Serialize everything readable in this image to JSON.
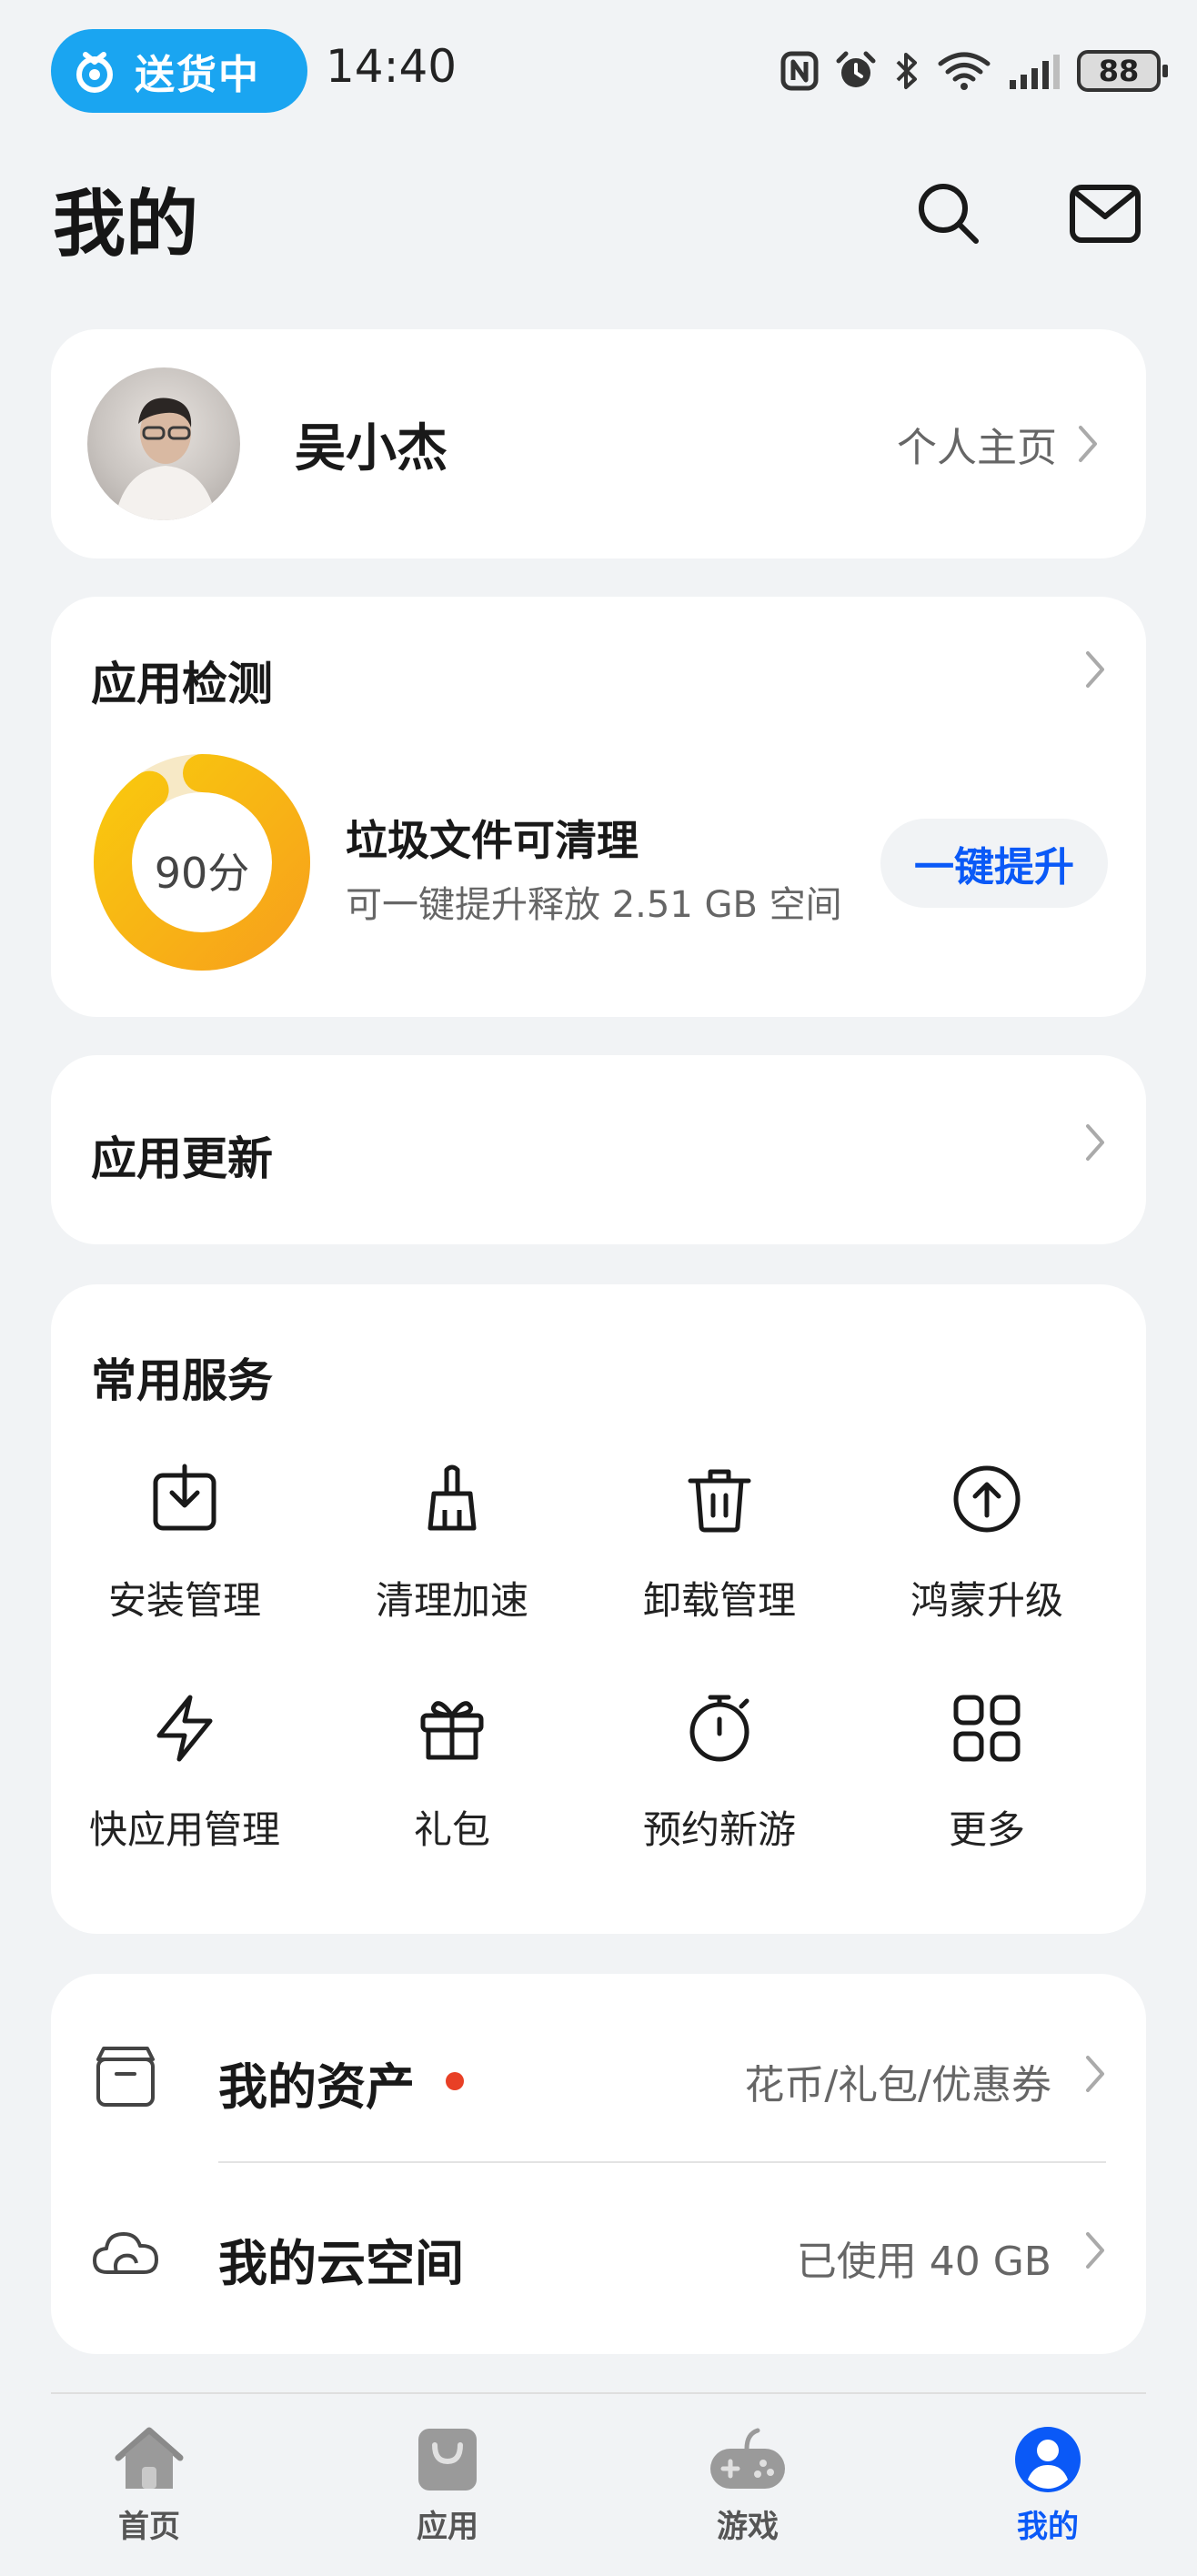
{
  "status_bar": {
    "delivery_label": "送货中",
    "time": "14:40",
    "battery": "88"
  },
  "header": {
    "title": "我的",
    "icons": [
      "search-icon",
      "mail-icon"
    ]
  },
  "profile": {
    "name": "吴小杰",
    "link_label": "个人主页"
  },
  "app_check": {
    "title": "应用检测",
    "score_label": "90分",
    "score": 90,
    "junk_title": "垃圾文件可清理",
    "junk_subtitle": "可一键提升释放 2.51 GB 空间",
    "button_label": "一键提升",
    "ring_colors": [
      "#f7a21b",
      "#f9c80e"
    ]
  },
  "app_update": {
    "title": "应用更新"
  },
  "services": {
    "title": "常用服务",
    "items": [
      {
        "label": "安装管理",
        "icon": "install-icon"
      },
      {
        "label": "清理加速",
        "icon": "broom-icon"
      },
      {
        "label": "卸载管理",
        "icon": "trash-icon"
      },
      {
        "label": "鸿蒙升级",
        "icon": "upgrade-icon"
      },
      {
        "label": "快应用管理",
        "icon": "lightning-icon"
      },
      {
        "label": "礼包",
        "icon": "gift-icon"
      },
      {
        "label": "预约新游",
        "icon": "stopwatch-icon"
      },
      {
        "label": "更多",
        "icon": "grid-icon"
      }
    ]
  },
  "assets": {
    "rows": [
      {
        "title": "我的资产",
        "value": "花币/礼包/优惠券",
        "icon": "box-icon",
        "has_dot": true
      },
      {
        "title": "我的云空间",
        "value": "已使用 40 GB",
        "icon": "cloud-icon",
        "has_dot": false
      }
    ]
  },
  "tabs": [
    {
      "label": "首页",
      "icon": "home-icon",
      "active": false
    },
    {
      "label": "应用",
      "icon": "bag-icon",
      "active": false
    },
    {
      "label": "游戏",
      "icon": "gamepad-icon",
      "active": false
    },
    {
      "label": "我的",
      "icon": "person-icon",
      "active": true
    }
  ],
  "colors": {
    "accent": "#0a59f7",
    "delivery_pill": "#1aa5f1",
    "badge_dot": "#e84026",
    "background": "#f1f3f5"
  }
}
